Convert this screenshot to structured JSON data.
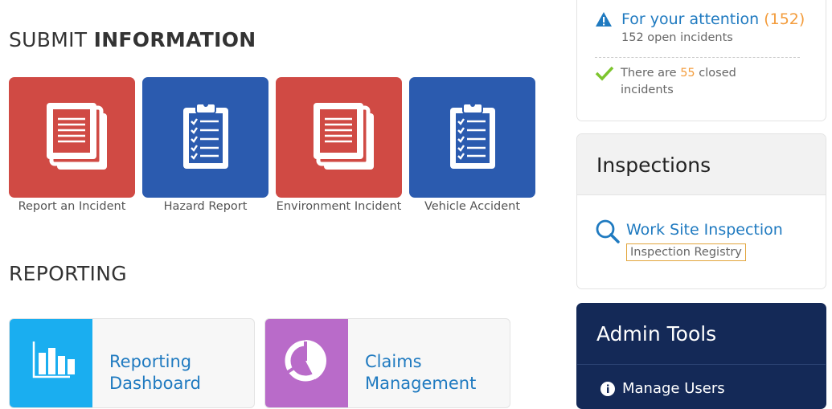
{
  "submit": {
    "title_prefix": "SUBMIT",
    "title_emphasis": "INFORMATION",
    "tiles": [
      {
        "label": "Report an Incident",
        "color": "#d04a44",
        "icon": "documents-icon"
      },
      {
        "label": "Hazard Report",
        "color": "#2b5baf",
        "icon": "clipboard-checklist-icon"
      },
      {
        "label": "Environment Incident",
        "color": "#d04a44",
        "icon": "documents-icon"
      },
      {
        "label": "Vehicle Accident",
        "color": "#2b5baf",
        "icon": "clipboard-checklist-icon"
      }
    ]
  },
  "reporting": {
    "title": "REPORTING",
    "cards": [
      {
        "line1": "Reporting",
        "line2": "Dashboard",
        "color": "#1aaef0",
        "icon": "bar-chart-icon"
      },
      {
        "line1": "Claims",
        "line2": "Management",
        "color": "#b96bc9",
        "icon": "pie-chart-icon"
      }
    ]
  },
  "attention": {
    "title": "For your attention",
    "count": "(152)",
    "subtitle": "152 open incidents",
    "closed_prefix": "There are",
    "closed_count": "55",
    "closed_suffix": "closed incidents"
  },
  "inspections": {
    "title": "Inspections",
    "link": "Work Site Inspection",
    "registry": "Inspection Registry"
  },
  "admin": {
    "title": "Admin Tools",
    "items": [
      {
        "label": "Manage Users",
        "icon": "info-icon"
      }
    ]
  },
  "colors": {
    "red_tile": "#d04a44",
    "blue_tile": "#2b5baf",
    "link_blue": "#1f7ac0",
    "accent_orange": "#f39c3c",
    "admin_navy": "#142957"
  }
}
